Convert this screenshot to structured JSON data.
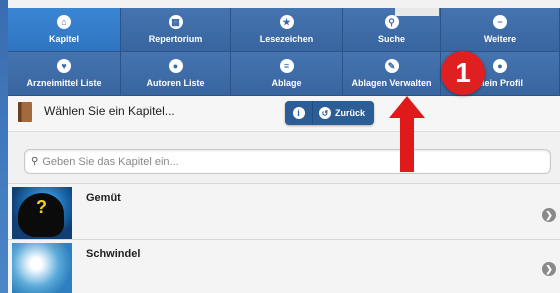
{
  "nav": {
    "row1": [
      {
        "label": "Kapitel",
        "icon": "home-icon",
        "glyph": "⌂",
        "active": true
      },
      {
        "label": "Repertorium",
        "icon": "grid-icon",
        "glyph": "▦"
      },
      {
        "label": "Lesezeichen",
        "icon": "star-icon",
        "glyph": "★"
      },
      {
        "label": "Suche",
        "icon": "search-icon",
        "glyph": "⚲"
      },
      {
        "label": "Weitere",
        "icon": "minus-icon",
        "glyph": "−"
      }
    ],
    "row2": [
      {
        "label": "Arzneimittel Liste",
        "icon": "heart-icon",
        "glyph": "♥"
      },
      {
        "label": "Autoren Liste",
        "icon": "user-icon",
        "glyph": "●"
      },
      {
        "label": "Ablage",
        "icon": "list-icon",
        "glyph": "≡"
      },
      {
        "label": "Ablagen Verwalten",
        "icon": "pencil-icon",
        "glyph": "✎"
      },
      {
        "label": "Mein Profil",
        "icon": "user-icon",
        "glyph": "●"
      }
    ]
  },
  "badge": "1",
  "chapter": {
    "label": "Wählen Sie ein Kapitel...",
    "info_glyph": "i",
    "back_label": "Zurück",
    "back_glyph": "↺"
  },
  "search": {
    "placeholder": "Geben Sie das Kapitel ein...",
    "glyph": "⚲"
  },
  "list": [
    {
      "title": "Gemüt",
      "thumb_text": "?"
    },
    {
      "title": "Schwindel"
    }
  ],
  "go_glyph": "❯",
  "colors": {
    "nav": "#3d6aa5",
    "nav_active": "#2f74c0",
    "button": "#2d5d95",
    "annotation": "#e01a1a"
  }
}
